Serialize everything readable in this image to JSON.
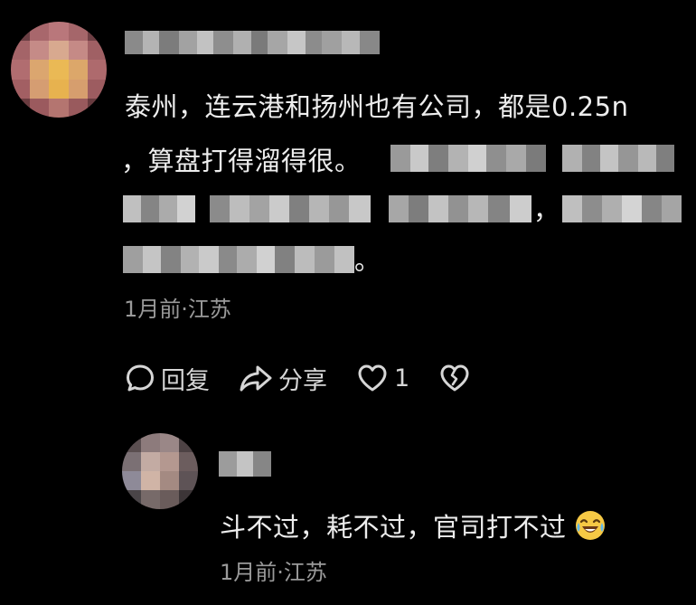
{
  "comment": {
    "text_line1": "泰州，连云港和扬州也有公司，都是0.25n",
    "text_line2_start": "，算盘打得溜得很。",
    "text_line3_sep1": "，",
    "text_line3_sep2": "，",
    "text_line4_end": "。",
    "meta": "1月前·江苏",
    "actions": {
      "reply_label": "回复",
      "share_label": "分享",
      "like_count": "1"
    }
  },
  "reply": {
    "text": "斗不过，耗不过，官司打不过",
    "emoji": "crying-laughing-face-emoji",
    "meta": "1月前·江苏"
  },
  "colors": {
    "background": "#000000",
    "text": "#ededed",
    "meta": "#9a9a9a",
    "icon": "#d6d6d6",
    "emoji_yellow": "#f6c945"
  }
}
